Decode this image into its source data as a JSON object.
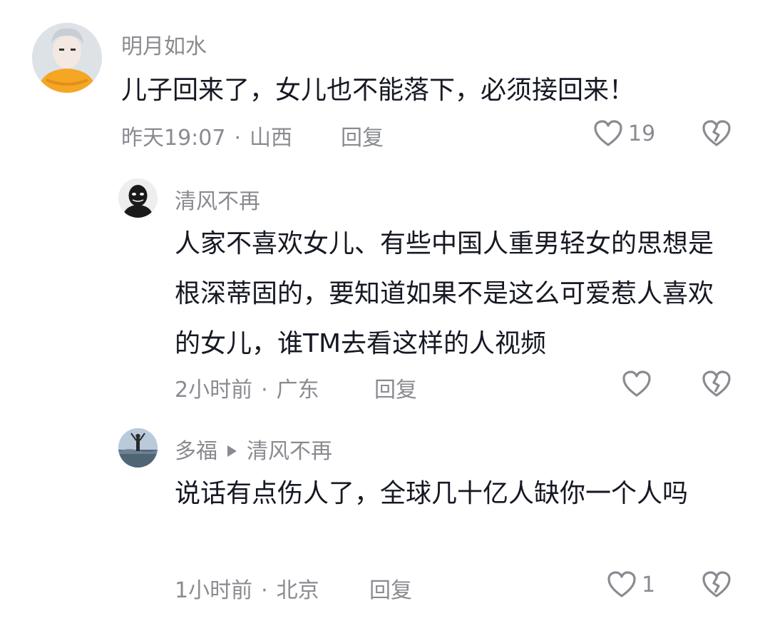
{
  "comments": [
    {
      "author": "明月如水",
      "text": "儿子回来了，女儿也不能落下，必须接回来！",
      "time": "昨天19:07",
      "location": "山西",
      "reply_label": "回复",
      "like_count": "19"
    },
    {
      "author": "清风不再",
      "text": "人家不喜欢女儿、有些中国人重男轻女的思想是根深蒂固的，要知道如果不是这么可爱惹人喜欢的女儿，谁TM去看这样的人视频",
      "time": "2小时前",
      "location": "广东",
      "reply_label": "回复",
      "like_count": ""
    },
    {
      "author": "多福",
      "reply_to": "清风不再",
      "text": "说话有点伤人了，全球几十亿人缺你一个人吗",
      "time": "1小时前",
      "location": "北京",
      "reply_label": "回复",
      "like_count": "1"
    }
  ],
  "meta_separator": "·",
  "icons": {
    "like": "heart-outline-icon",
    "dislike": "broken-heart-icon",
    "reply_arrow": "triangle-right-icon"
  },
  "colors": {
    "text": "#161823",
    "secondary": "#8a8b91",
    "avatar1_scarf": "#f5a623"
  }
}
